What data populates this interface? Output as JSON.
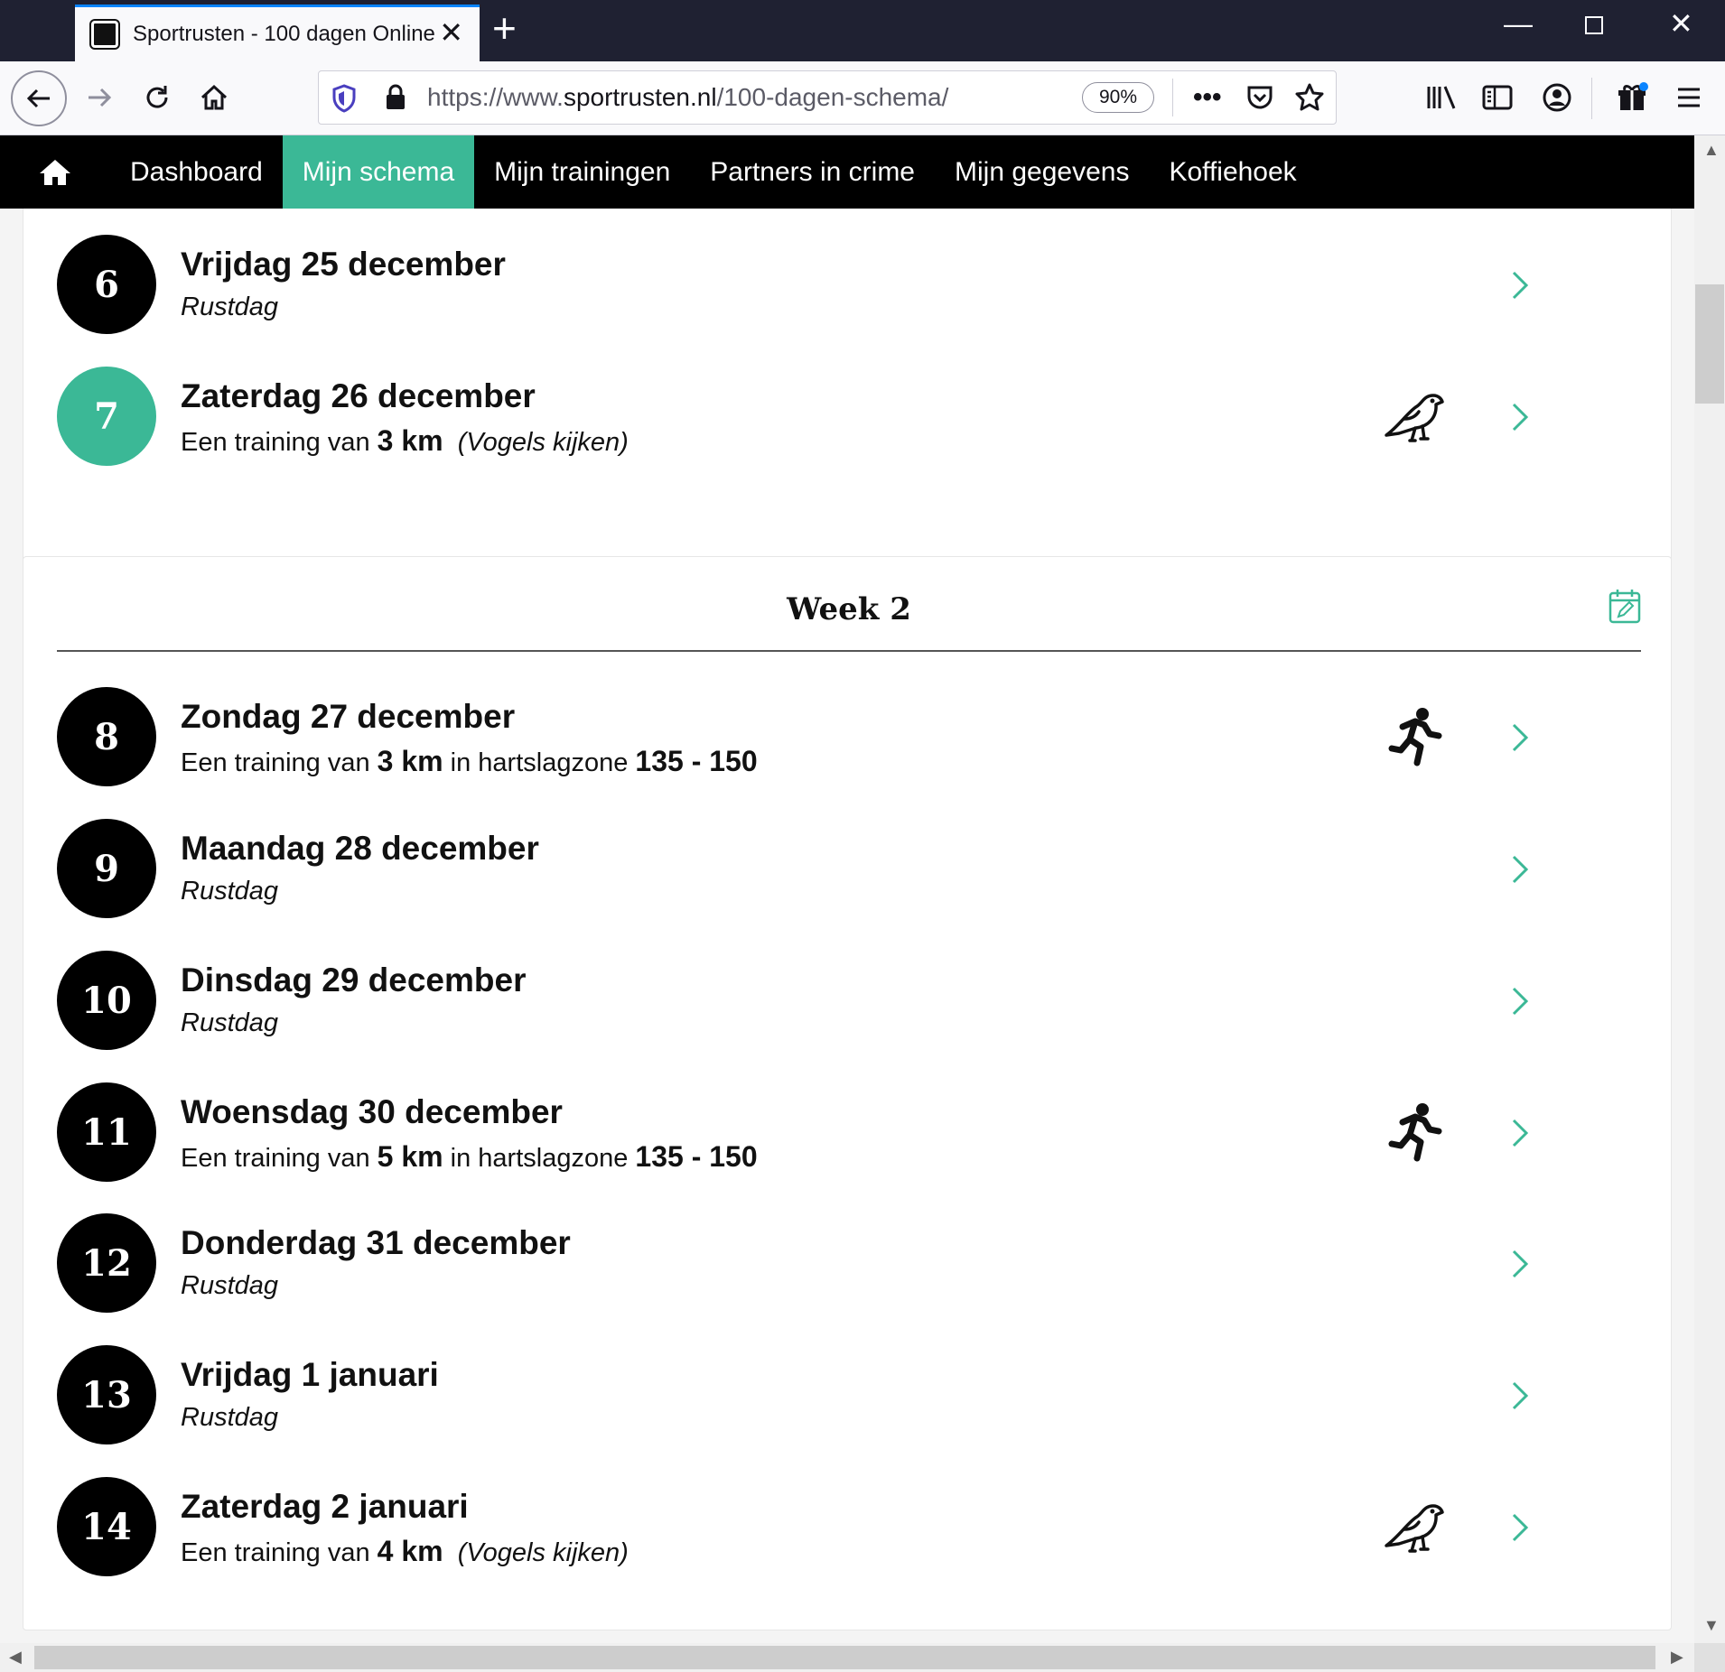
{
  "browser": {
    "tab_title": "Sportrusten - 100 dagen Online",
    "url_prefix": "https://www.",
    "url_domain": "sportrusten.nl",
    "url_path": "/100-dagen-schema/",
    "zoom": "90%"
  },
  "sitenav": {
    "items": [
      "Dashboard",
      "Mijn schema",
      "Mijn trainingen",
      "Partners in crime",
      "Mijn gegevens",
      "Koffiehoek"
    ],
    "active": "Mijn schema"
  },
  "colors": {
    "accent": "#3bb896",
    "nav_bg": "#000000"
  },
  "week1": {
    "days": [
      {
        "num": "6",
        "title": "Vrijdag 25 december",
        "rest": "Rustdag",
        "icon": "none"
      },
      {
        "num": "7",
        "title": "Zaterdag 26 december",
        "pre": "Een training van",
        "km": "3 km",
        "note": "(Vogels kijken)",
        "icon": "bird-icon"
      }
    ]
  },
  "week2": {
    "title": "Week 2",
    "days": [
      {
        "num": "8",
        "title": "Zondag 27 december",
        "pre": "Een training van",
        "km": "3 km",
        "mid": "in hartslagzone",
        "zone": "135 - 150",
        "icon": "runner-icon"
      },
      {
        "num": "9",
        "title": "Maandag 28 december",
        "rest": "Rustdag",
        "icon": "none"
      },
      {
        "num": "10",
        "title": "Dinsdag 29 december",
        "rest": "Rustdag",
        "icon": "none"
      },
      {
        "num": "11",
        "title": "Woensdag 30 december",
        "pre": "Een training van",
        "km": "5 km",
        "mid": "in hartslagzone",
        "zone": "135 - 150",
        "icon": "runner-icon"
      },
      {
        "num": "12",
        "title": "Donderdag 31 december",
        "rest": "Rustdag",
        "icon": "none"
      },
      {
        "num": "13",
        "title": "Vrijdag 1 januari",
        "rest": "Rustdag",
        "icon": "none"
      },
      {
        "num": "14",
        "title": "Zaterdag 2 januari",
        "pre": "Een training van",
        "km": "4 km",
        "note": "(Vogels kijken)",
        "icon": "bird-icon"
      }
    ]
  }
}
